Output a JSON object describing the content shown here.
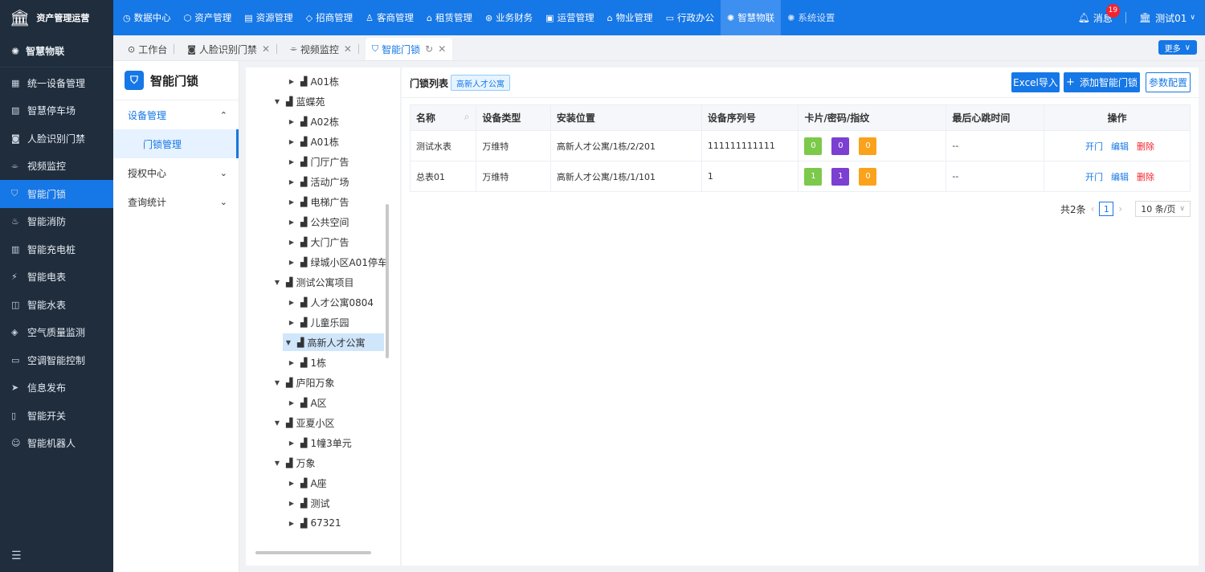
{
  "brand": {
    "title": "资产管理运营"
  },
  "topnav": [
    {
      "icon": "◷",
      "icon_name": "dashboard-icon",
      "label": "数据中心"
    },
    {
      "icon": "⬡",
      "icon_name": "cube-icon",
      "label": "资产管理"
    },
    {
      "icon": "▤",
      "icon_name": "resource-icon",
      "label": "资源管理"
    },
    {
      "icon": "◇",
      "icon_name": "diamond-icon",
      "label": "招商管理"
    },
    {
      "icon": "♙",
      "icon_name": "customer-icon",
      "label": "客商管理"
    },
    {
      "icon": "⌂",
      "icon_name": "home-icon",
      "label": "租赁管理"
    },
    {
      "icon": "⊛",
      "icon_name": "finance-icon",
      "label": "业务财务"
    },
    {
      "icon": "▣",
      "icon_name": "operations-icon",
      "label": "运营管理"
    },
    {
      "icon": "⌂",
      "icon_name": "property-icon",
      "label": "物业管理"
    },
    {
      "icon": "▭",
      "icon_name": "office-icon",
      "label": "行政办公"
    },
    {
      "icon": "✺",
      "icon_name": "iot-icon",
      "label": "智慧物联"
    },
    {
      "icon": "✺",
      "icon_name": "settings-icon",
      "label": "系统设置"
    }
  ],
  "topright": {
    "message_label": "消息",
    "message_count": "19",
    "user": "测试01"
  },
  "sidebar": {
    "header": "智慧物联",
    "items": [
      {
        "icon": "▦",
        "icon_name": "device-manage-icon",
        "label": "统一设备管理"
      },
      {
        "icon": "▧",
        "icon_name": "parking-icon",
        "label": "智慧停车场"
      },
      {
        "icon": "◙",
        "icon_name": "face-access-icon",
        "label": "人脸识别门禁"
      },
      {
        "icon": "⌯",
        "icon_name": "video-icon",
        "label": "视频监控"
      },
      {
        "icon": "⛉",
        "icon_name": "lock-icon",
        "label": "智能门锁"
      },
      {
        "icon": "♨",
        "icon_name": "fire-icon",
        "label": "智能消防"
      },
      {
        "icon": "▥",
        "icon_name": "charging-icon",
        "label": "智能充电桩"
      },
      {
        "icon": "⚡",
        "icon_name": "meter-icon",
        "label": "智能电表"
      },
      {
        "icon": "◫",
        "icon_name": "water-meter-icon",
        "label": "智能水表"
      },
      {
        "icon": "◈",
        "icon_name": "air-quality-icon",
        "label": "空气质量监测"
      },
      {
        "icon": "▭",
        "icon_name": "ac-control-icon",
        "label": "空调智能控制"
      },
      {
        "icon": "➤",
        "icon_name": "publish-icon",
        "label": "信息发布"
      },
      {
        "icon": "▯",
        "icon_name": "switch-icon",
        "label": "智能开关"
      },
      {
        "icon": "☺",
        "icon_name": "robot-icon",
        "label": "智能机器人"
      }
    ]
  },
  "tabs": [
    {
      "icon": "⊙",
      "label": "工作台",
      "closable": false
    },
    {
      "icon": "◙",
      "label": "人脸识别门禁",
      "closable": true
    },
    {
      "icon": "⌯",
      "label": "视频监控",
      "closable": true
    },
    {
      "icon": "⛉",
      "label": "智能门锁",
      "closable": true,
      "active": true
    }
  ],
  "more_button": "更多",
  "submenu": {
    "title": "智能门锁",
    "groups": [
      {
        "label": "设备管理",
        "open": true,
        "children": [
          "门锁管理"
        ]
      },
      {
        "label": "授权中心",
        "open": false
      },
      {
        "label": "查询统计",
        "open": false
      }
    ]
  },
  "tree": [
    {
      "label": "A01栋",
      "level": 2,
      "expanded": false
    },
    {
      "label": "蓝蝶苑",
      "level": 1,
      "expanded": true
    },
    {
      "label": "A02栋",
      "level": 2,
      "expanded": false
    },
    {
      "label": "A01栋",
      "level": 2,
      "expanded": false
    },
    {
      "label": "门厅广告",
      "level": 2,
      "expanded": false
    },
    {
      "label": "活动广场",
      "level": 2,
      "expanded": false
    },
    {
      "label": "电梯广告",
      "level": 2,
      "expanded": false
    },
    {
      "label": "公共空间",
      "level": 2,
      "expanded": false
    },
    {
      "label": "大门广告",
      "level": 2,
      "expanded": false
    },
    {
      "label": "绿城小区A01停车",
      "level": 2,
      "expanded": false
    },
    {
      "label": "测试公寓项目",
      "level": 1,
      "expanded": true
    },
    {
      "label": "人才公寓0804",
      "level": 2,
      "expanded": false
    },
    {
      "label": "儿童乐园",
      "level": 2,
      "expanded": false
    },
    {
      "label": "高新人才公寓",
      "level": 1,
      "expanded": true,
      "selected": true
    },
    {
      "label": "1栋",
      "level": 2,
      "expanded": false
    },
    {
      "label": "庐阳万象",
      "level": 1,
      "expanded": true
    },
    {
      "label": "A区",
      "level": 2,
      "expanded": false
    },
    {
      "label": "亚夏小区",
      "level": 1,
      "expanded": true
    },
    {
      "label": "1幢3单元",
      "level": 2,
      "expanded": false
    },
    {
      "label": "万象",
      "level": 1,
      "expanded": true
    },
    {
      "label": "A座",
      "level": 2,
      "expanded": false
    },
    {
      "label": "测试",
      "level": 2,
      "expanded": false
    },
    {
      "label": "67321",
      "level": 2,
      "expanded": false
    }
  ],
  "list": {
    "title": "门锁列表",
    "filter_tag": "高新人才公寓",
    "buttons": {
      "import": "Excel导入",
      "add": "添加智能门锁",
      "config": "参数配置"
    },
    "columns": [
      "名称",
      "设备类型",
      "安装位置",
      "设备序列号",
      "卡片/密码/指纹",
      "最后心跳时间",
      "操作"
    ],
    "rows": [
      {
        "name": "测试水表",
        "type": "万维特",
        "location": "高新人才公寓/1栋/2/201",
        "serial": "111111111111",
        "card": "0",
        "password": "0",
        "fingerprint": "0",
        "heartbeat": "--"
      },
      {
        "name": "总表01",
        "type": "万维特",
        "location": "高新人才公寓/1栋/1/101",
        "serial": "1",
        "card": "1",
        "password": "1",
        "fingerprint": "0",
        "heartbeat": "--"
      }
    ],
    "actions": {
      "open": "开门",
      "edit": "编辑",
      "delete": "删除"
    },
    "pager": {
      "total": "共2条",
      "current": "1",
      "page_size": "10 条/页"
    }
  },
  "colors": {
    "primary": "#1677e6",
    "sidebar_bg": "#1f2d3d",
    "danger": "#f5222d",
    "chip_green": "#7cc94b",
    "chip_purple": "#7b3fd1",
    "chip_orange": "#faa21b"
  }
}
